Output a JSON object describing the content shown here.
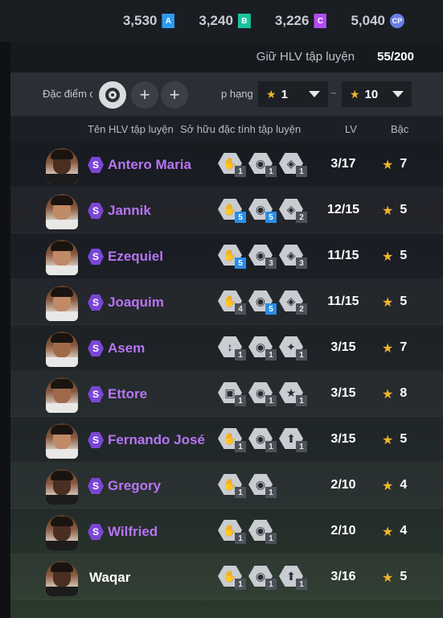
{
  "currencies": [
    {
      "amount": "3,530",
      "badge": "A",
      "color": "blue"
    },
    {
      "amount": "3,240",
      "badge": "B",
      "color": "teal"
    },
    {
      "amount": "3,226",
      "badge": "C",
      "color": "purple"
    },
    {
      "amount": "5,040",
      "badge": "CP",
      "color": "cp"
    }
  ],
  "holder": {
    "label": "Giữ HLV tập luyện",
    "value": "55/200"
  },
  "filters": {
    "trait_label": "Đặc điểm c",
    "rank_label": "p hạng",
    "min_rank": "1",
    "max_rank": "10",
    "tilde": "~"
  },
  "columns": {
    "name": "Tên HLV tập luyện",
    "traits": "Sở hữu đặc tính tập luyện",
    "lv": "LV",
    "grade": "Bậc"
  },
  "rows": [
    {
      "name": "Antero Maria",
      "special": true,
      "lv": "3/17",
      "grade": "7",
      "avatar": "dark",
      "traits": [
        {
          "icon": "✋",
          "level": "1",
          "hi": false
        },
        {
          "icon": "◉",
          "level": "1",
          "hi": false
        },
        {
          "icon": "◈",
          "level": "1",
          "hi": false
        }
      ]
    },
    {
      "name": "Jannik",
      "special": true,
      "lv": "12/15",
      "grade": "5",
      "avatar": "light",
      "traits": [
        {
          "icon": "✋",
          "level": "5",
          "hi": true
        },
        {
          "icon": "◉",
          "level": "5",
          "hi": true
        },
        {
          "icon": "◈",
          "level": "2",
          "hi": false
        }
      ]
    },
    {
      "name": "Ezequiel",
      "special": true,
      "lv": "11/15",
      "grade": "5",
      "avatar": "light",
      "traits": [
        {
          "icon": "✋",
          "level": "5",
          "hi": true
        },
        {
          "icon": "◉",
          "level": "3",
          "hi": false
        },
        {
          "icon": "◈",
          "level": "3",
          "hi": false
        }
      ]
    },
    {
      "name": "Joaquim",
      "special": true,
      "lv": "11/15",
      "grade": "5",
      "avatar": "light",
      "traits": [
        {
          "icon": "✋",
          "level": "4",
          "hi": false
        },
        {
          "icon": "◉",
          "level": "5",
          "hi": true
        },
        {
          "icon": "◈",
          "level": "2",
          "hi": false
        }
      ]
    },
    {
      "name": "Asem",
      "special": true,
      "lv": "3/15",
      "grade": "7",
      "avatar": "normal",
      "traits": [
        {
          "icon": "↕",
          "level": "1",
          "hi": false
        },
        {
          "icon": "◉",
          "level": "1",
          "hi": false
        },
        {
          "icon": "✦",
          "level": "1",
          "hi": false
        }
      ]
    },
    {
      "name": "Ettore",
      "special": true,
      "lv": "3/15",
      "grade": "8",
      "avatar": "normal",
      "traits": [
        {
          "icon": "▣",
          "level": "1",
          "hi": false
        },
        {
          "icon": "◉",
          "level": "1",
          "hi": false
        },
        {
          "icon": "★",
          "level": "1",
          "hi": false
        }
      ]
    },
    {
      "name": "Fernando José",
      "special": true,
      "lv": "3/15",
      "grade": "5",
      "avatar": "light",
      "traits": [
        {
          "icon": "✋",
          "level": "1",
          "hi": false
        },
        {
          "icon": "◉",
          "level": "1",
          "hi": false
        },
        {
          "icon": "⬆",
          "level": "1",
          "hi": false
        }
      ]
    },
    {
      "name": "Gregory",
      "special": true,
      "lv": "2/10",
      "grade": "4",
      "avatar": "dark",
      "traits": [
        {
          "icon": "✋",
          "level": "1",
          "hi": false
        },
        {
          "icon": "◉",
          "level": "1",
          "hi": false
        }
      ]
    },
    {
      "name": "Wilfried",
      "special": true,
      "lv": "2/10",
      "grade": "4",
      "avatar": "dark",
      "traits": [
        {
          "icon": "✋",
          "level": "1",
          "hi": false
        },
        {
          "icon": "◉",
          "level": "1",
          "hi": false
        }
      ]
    },
    {
      "name": "Waqar",
      "special": false,
      "lv": "3/16",
      "grade": "5",
      "avatar": "dark",
      "traits": [
        {
          "icon": "✋",
          "level": "1",
          "hi": false
        },
        {
          "icon": "◉",
          "level": "1",
          "hi": false
        },
        {
          "icon": "⬆",
          "level": "1",
          "hi": false
        }
      ]
    }
  ]
}
